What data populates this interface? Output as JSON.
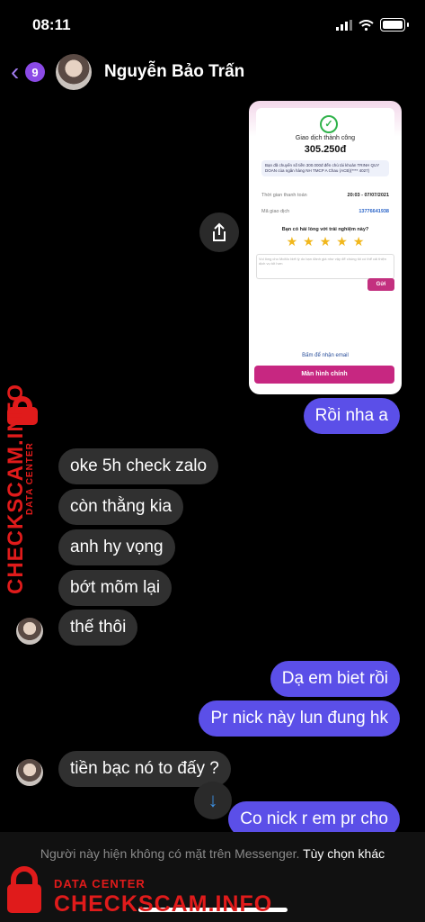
{
  "status": {
    "time": "08:11"
  },
  "header": {
    "unread_count": "9",
    "contact_name": "Nguyễn Bảo Trấn"
  },
  "screenshot": {
    "title": "Giao dịch thành công",
    "amount": "305.250đ",
    "note": "Bạn đã chuyển số tiền 300.000đ đến chủ tài khoản TRINH QUY DOAN của ngân hàng NH TMCP A Chau (ACB)(**** 4027)",
    "time_label": "Thời gian thanh toán",
    "time_value": "20:03 - 07/07/2021",
    "code_label": "Mã giao dịch",
    "code_value": "13776641938",
    "rating_question": "Bạn có hài lòng với trải nghiệm này?",
    "feedback_placeholder": "Vui lòng cho MoMo biết lý do bạn đánh giá như vậy để chúng tôi có thể cải thiện dịch vụ tốt hơn",
    "send_label": "Gửi",
    "email_label": "Bấm để nhận email",
    "home_label": "Màn hình chính"
  },
  "messages": [
    {
      "from": "me",
      "text": "Rồi nha a"
    },
    {
      "from": "them",
      "text": "oke 5h check zalo"
    },
    {
      "from": "them",
      "text": "còn thằng kia"
    },
    {
      "from": "them",
      "text": "anh hy vọng"
    },
    {
      "from": "them",
      "text": "bớt mõm lại"
    },
    {
      "from": "them",
      "text": "thế thôi"
    },
    {
      "from": "me",
      "text": "Dạ em biet rồi"
    },
    {
      "from": "me",
      "text": "Pr nick này lun đung hk"
    },
    {
      "from": "them",
      "text": "tiền bạc nó to đấy ?"
    },
    {
      "from": "me",
      "text": "Co nick r em pr cho"
    }
  ],
  "footer": {
    "notice": "Người này hiện không có mặt trên Messenger.",
    "more_options": "Tùy chọn khác"
  },
  "watermark": {
    "small": "DATA CENTER",
    "big": "CHECKSCAM.INFO"
  },
  "colors": {
    "outgoing": "#5b4fe8",
    "incoming": "#303030",
    "accent": "#8b4ae6",
    "watermark": "#e01b1b"
  }
}
